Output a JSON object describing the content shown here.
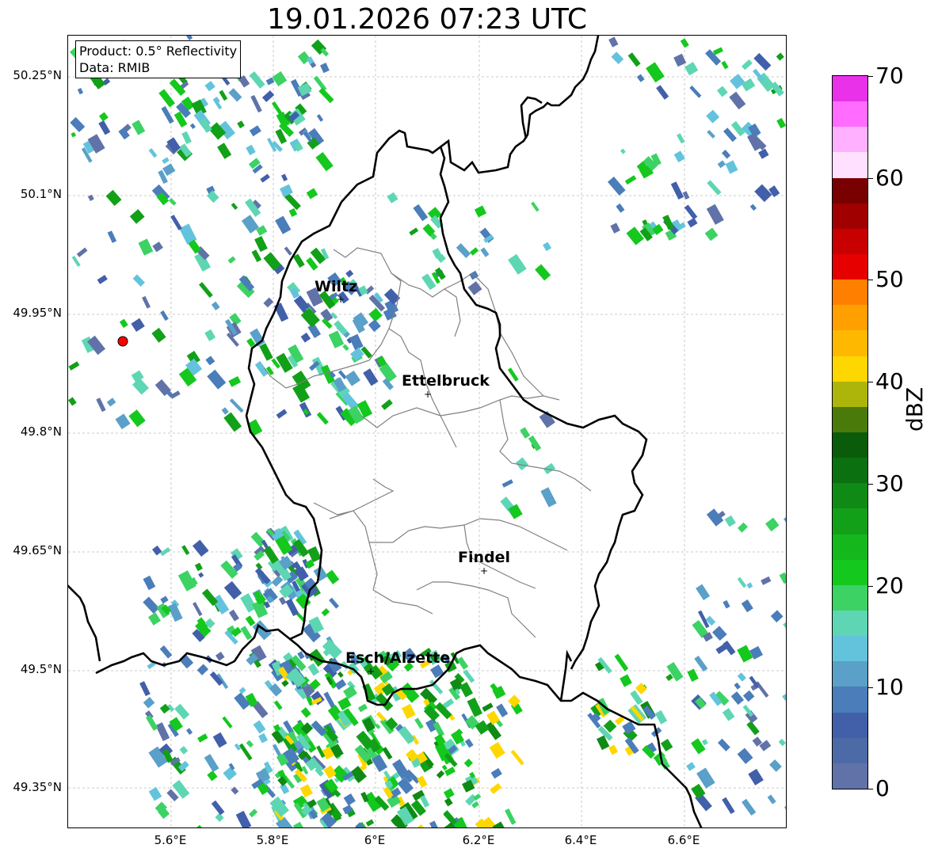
{
  "title": "19.01.2026 07:23 UTC",
  "info": {
    "product": "Product: 0.5° Reflectivity",
    "data_source": "Data: RMIB"
  },
  "latitude_labels": [
    "50.25°N",
    "50.1°N",
    "49.95°N",
    "49.8°N",
    "49.65°N",
    "49.5°N",
    "49.35°N"
  ],
  "longitude_labels": [
    "5.6°E",
    "5.8°E",
    "6°E",
    "6.2°E",
    "6.4°E",
    "6.6°E"
  ],
  "cities": [
    {
      "name": "Wiltz"
    },
    {
      "name": "Ettelbruck"
    },
    {
      "name": "Findel"
    },
    {
      "name": "Esch/Alzette"
    }
  ],
  "colorbar": {
    "label": "dBZ",
    "ticks": [
      "70",
      "60",
      "50",
      "40",
      "30",
      "20",
      "10",
      "0"
    ],
    "colors": [
      "#e831e8",
      "#ff6cff",
      "#ffb1ff",
      "#ffe0ff",
      "#780000",
      "#a00000",
      "#c80000",
      "#e60000",
      "#ff8000",
      "#ff9f00",
      "#ffb800",
      "#ffd700",
      "#adb50a",
      "#4a7a0a",
      "#0a5c0a",
      "#0a7010",
      "#0f8a14",
      "#12a018",
      "#14b81c",
      "#14c81e",
      "#3cd264",
      "#5ed6b4",
      "#64c3dc",
      "#5aa0c8",
      "#4a7db9",
      "#425faa",
      "#4c6aa6",
      "#6172a8"
    ]
  },
  "colors": {
    "border_country": "#000000",
    "border_canton": "#808080",
    "radar_site": "#ff0000"
  }
}
